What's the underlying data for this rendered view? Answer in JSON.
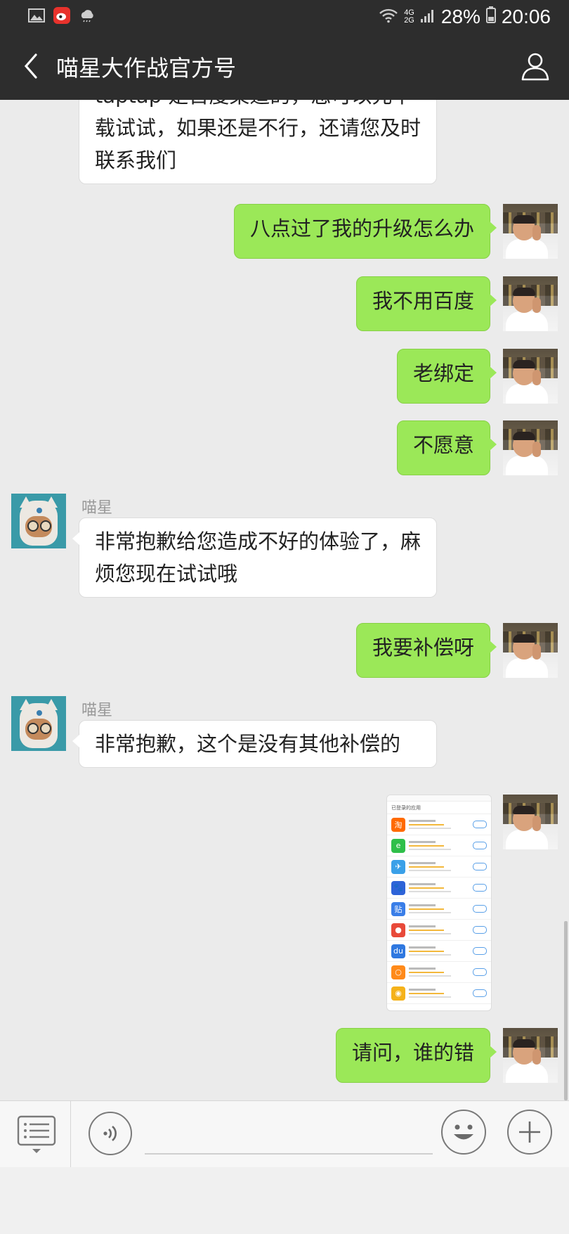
{
  "status_bar": {
    "network_top": "4G",
    "network_bottom": "2G",
    "battery": "28%",
    "time": "20:06",
    "icons": [
      "gallery-icon",
      "weibo-icon",
      "weather-icon",
      "wifi-icon",
      "signal-icon",
      "battery-icon"
    ]
  },
  "header": {
    "title": "喵星大作战官方号",
    "back_icon": "chevron-left-icon",
    "profile_icon": "person-icon"
  },
  "messages": [
    {
      "side": "in",
      "lines": [
        "taptap 是百度渠道的，您可以先下",
        "载试试，如果还是不行，还请您及时",
        "联系我们"
      ]
    },
    {
      "side": "out",
      "text": "八点过了我的升级怎么办"
    },
    {
      "side": "out",
      "text": "我不用百度"
    },
    {
      "side": "out",
      "text": "老绑定"
    },
    {
      "side": "out",
      "text": "不愿意"
    },
    {
      "side": "in",
      "sender": "喵星",
      "lines": [
        "非常抱歉给您造成不好的体验了，麻",
        "烦您现在试试哦"
      ]
    },
    {
      "side": "out",
      "text": "我要补偿呀"
    },
    {
      "side": "in",
      "sender": "喵星",
      "lines": [
        "非常抱歉，这个是没有其他补偿的"
      ]
    },
    {
      "side": "out",
      "type": "image",
      "image_title": "已登录的应用"
    },
    {
      "side": "out",
      "text": "请问，谁的错"
    }
  ],
  "image_apps": [
    {
      "glyph": "淘",
      "color": "#ff6a00"
    },
    {
      "glyph": "e",
      "color": "#2fbf4a"
    },
    {
      "glyph": "✈",
      "color": "#3aa0e8"
    },
    {
      "glyph": "🐾",
      "color": "#2e63d8"
    },
    {
      "glyph": "贴",
      "color": "#3a7ee8"
    },
    {
      "glyph": "●",
      "color": "#e84a3a"
    },
    {
      "glyph": "du",
      "color": "#2f78e0"
    },
    {
      "glyph": "○",
      "color": "#ff8a1a"
    },
    {
      "glyph": "◉",
      "color": "#f5b21a"
    }
  ],
  "input_bar": {
    "menu_icon": "list-menu-icon",
    "voice_icon": "voice-icon",
    "emoji_icon": "emoji-icon",
    "plus_icon": "plus-icon",
    "placeholder": ""
  }
}
